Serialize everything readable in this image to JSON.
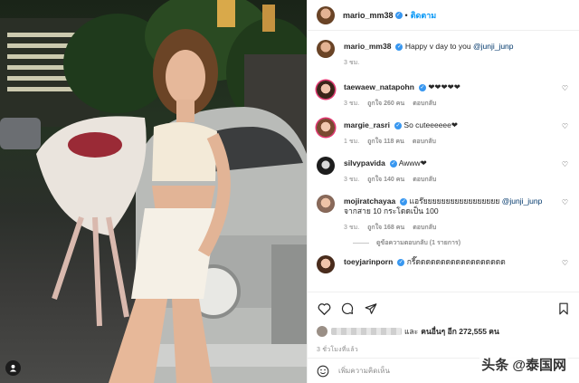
{
  "post": {
    "author": "mario_mm38",
    "follow_sep": "•",
    "follow_label": "ติดตาม"
  },
  "caption": {
    "username": "mario_mm38",
    "text": "Happy v day to you",
    "mention": "@junji_junp",
    "time": "3 ชม."
  },
  "comments": [
    {
      "username": "taewaew_natapohn",
      "text": "❤❤❤❤❤",
      "time": "3 ชม.",
      "likes": "ถูกใจ 260 คน",
      "reply": "ตอบกลับ"
    },
    {
      "username": "margie_rasri",
      "text": "So cuteeeeee❤",
      "time": "1 ชม.",
      "likes": "ถูกใจ 118 คน",
      "reply": "ตอบกลับ"
    },
    {
      "username": "silvypavida",
      "text": "Awww❤",
      "time": "3 ชม.",
      "likes": "ถูกใจ 140 คน",
      "reply": "ตอบกลับ"
    },
    {
      "username": "mojiratchayaa",
      "text": "แอร๊ยยยยยยยยยยยยยยยยย",
      "mention": "@junji_junp",
      "text2": "จากสาย 10 กระโดดเป็น 100",
      "time": "3 ชม.",
      "likes": "ถูกใจ 168 คน",
      "reply": "ตอบกลับ"
    },
    {
      "username": "toeyjarinporn",
      "text": "กรี๊ดดดดดดดดดดดดดดดดดด"
    }
  ],
  "view_replies": "ดูข้อความตอบกลับ (1 รายการ)",
  "likes_line": {
    "suffix_pre": "และ",
    "others": "คนอื่นๆ อีก 272,555 คน"
  },
  "posted_ago": "3 ชั่วโมงที่แล้ว",
  "add_comment_placeholder": "เพิ่มความคิดเห็น",
  "watermark": "头条 @泰国网",
  "icons": {
    "like": "heart-icon",
    "comment": "comment-icon",
    "share": "share-icon",
    "save": "bookmark-icon",
    "emoji": "emoji-icon",
    "tag": "user-tag-icon"
  },
  "colors": {
    "link": "#0095f6",
    "verified": "#3897f0",
    "muted": "#8e8e8e"
  }
}
